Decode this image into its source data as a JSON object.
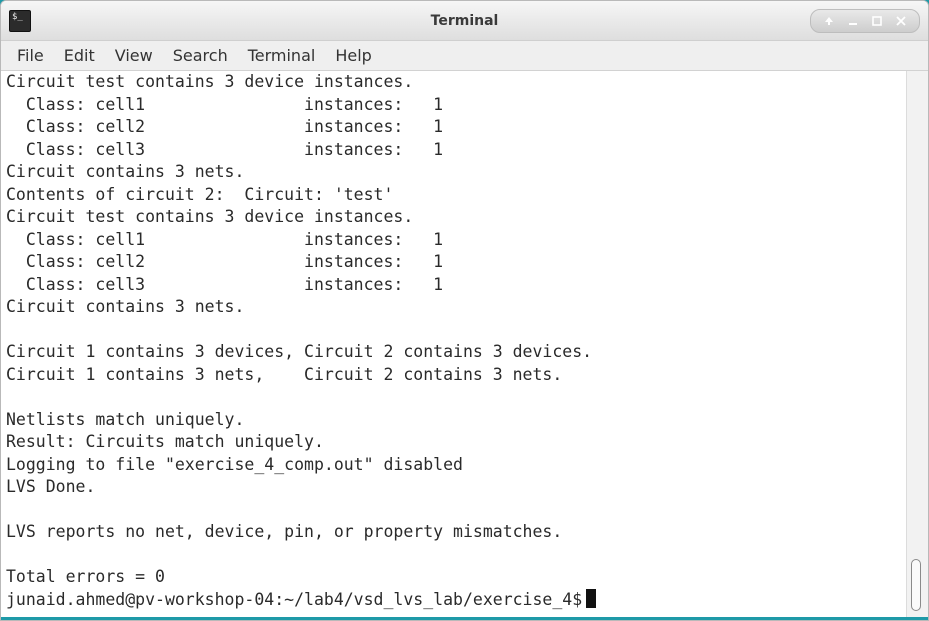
{
  "window": {
    "title": "Terminal",
    "controls": [
      "arrow-up-icon",
      "minimize-icon",
      "maximize-icon",
      "close-icon"
    ]
  },
  "menubar": {
    "items": [
      "File",
      "Edit",
      "View",
      "Search",
      "Terminal",
      "Help"
    ]
  },
  "terminal": {
    "lines": [
      "Circuit test contains 3 device instances.",
      "  Class: cell1                instances:   1",
      "  Class: cell2                instances:   1",
      "  Class: cell3                instances:   1",
      "Circuit contains 3 nets.",
      "Contents of circuit 2:  Circuit: 'test'",
      "Circuit test contains 3 device instances.",
      "  Class: cell1                instances:   1",
      "  Class: cell2                instances:   1",
      "  Class: cell3                instances:   1",
      "Circuit contains 3 nets.",
      "",
      "Circuit 1 contains 3 devices, Circuit 2 contains 3 devices.",
      "Circuit 1 contains 3 nets,    Circuit 2 contains 3 nets.",
      "",
      "Netlists match uniquely.",
      "Result: Circuits match uniquely.",
      "Logging to file \"exercise_4_comp.out\" disabled",
      "LVS Done.",
      "",
      "LVS reports no net, device, pin, or property mismatches.",
      "",
      "Total errors = 0"
    ],
    "prompt": "junaid.ahmed@pv-workshop-04:~/lab4/vsd_lvs_lab/exercise_4$"
  },
  "colors": {
    "desktop": "#1e9aa8",
    "terminal_bg": "#ffffff",
    "terminal_fg": "#2a2a2a"
  }
}
